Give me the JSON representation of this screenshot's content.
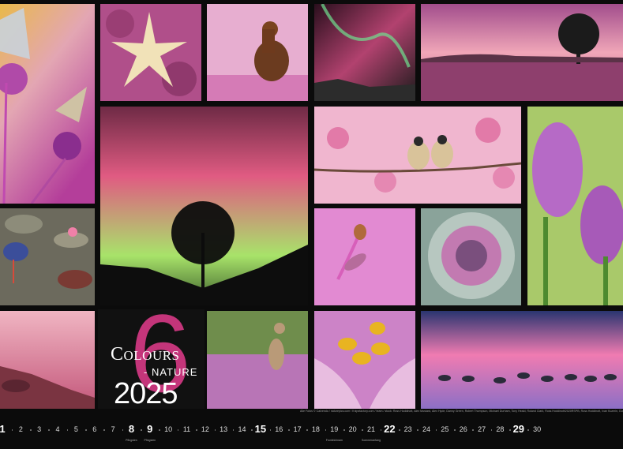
{
  "calendar": {
    "title_colours": "Colours",
    "title_nature": "- NATURE",
    "year": "2025",
    "month_number": "6",
    "credits": "Alle Fotos © Calvendo / naturepics.com / Knipsfactory.com / team / stock: Ross Hoddinott, Alex Mustard, Alex Hyde, Danny Green, Robert Thompson, Michael Durham, Tony Heald, Roland Clark, Ross Hoddinott/2020RSPB, Ross Hoddinott, Ivan Kuzmin, Guy Edwardes, Matthias Breiter, Mark Hamblin, David Kjaer, Nick Upton"
  },
  "days": [
    {
      "n": "1",
      "bold": true
    },
    {
      "n": "2"
    },
    {
      "n": "3"
    },
    {
      "n": "4"
    },
    {
      "n": "5"
    },
    {
      "n": "6"
    },
    {
      "n": "7"
    },
    {
      "n": "8",
      "bold": true,
      "note": "Pfingsten"
    },
    {
      "n": "9",
      "bold": true,
      "note": "Pfingsten"
    },
    {
      "n": "10"
    },
    {
      "n": "11"
    },
    {
      "n": "12"
    },
    {
      "n": "13"
    },
    {
      "n": "14"
    },
    {
      "n": "15",
      "bold": true
    },
    {
      "n": "16"
    },
    {
      "n": "17"
    },
    {
      "n": "18"
    },
    {
      "n": "19",
      "note": "Fronleichnam"
    },
    {
      "n": "20"
    },
    {
      "n": "21",
      "note": "Sommeranfang"
    },
    {
      "n": "22",
      "bold": true
    },
    {
      "n": "23"
    },
    {
      "n": "24"
    },
    {
      "n": "25"
    },
    {
      "n": "26"
    },
    {
      "n": "27"
    },
    {
      "n": "28"
    },
    {
      "n": "29",
      "bold": true
    },
    {
      "n": "30"
    }
  ],
  "photos": [
    {
      "name": "butterfly-photo",
      "desc": "blue butterflies on pink flower"
    },
    {
      "name": "starfish-photo",
      "desc": "starfish on pink heather"
    },
    {
      "name": "grouse-photo",
      "desc": "grouse bird in pink mist"
    },
    {
      "name": "aurora-photo-small",
      "desc": "aurora over cliff"
    },
    {
      "name": "sunrise-tree-photo",
      "desc": "tree at sunrise over heather"
    },
    {
      "name": "aurora-tree-photo",
      "desc": "tree silhouette under aurora"
    },
    {
      "name": "birds-blossom-photo",
      "desc": "two birds on cherry blossom"
    },
    {
      "name": "orchid-photo",
      "desc": "purple orchids"
    },
    {
      "name": "swamphen-photo",
      "desc": "purple swamphen on lily pads"
    },
    {
      "name": "insect-photo",
      "desc": "insects on pink flower"
    },
    {
      "name": "cabbage-photo",
      "desc": "ornamental cabbage"
    },
    {
      "name": "coast-photo",
      "desc": "rocky coast in pink light"
    },
    {
      "name": "deer-photo",
      "desc": "deer in heather"
    },
    {
      "name": "lily-photo",
      "desc": "lily stamens close-up"
    },
    {
      "name": "flamingo-photo",
      "desc": "flamingos in pink water"
    }
  ],
  "colors": {
    "accent_magenta": "#c4357a",
    "background": "#0b0b0b",
    "text": "#ffffff"
  }
}
